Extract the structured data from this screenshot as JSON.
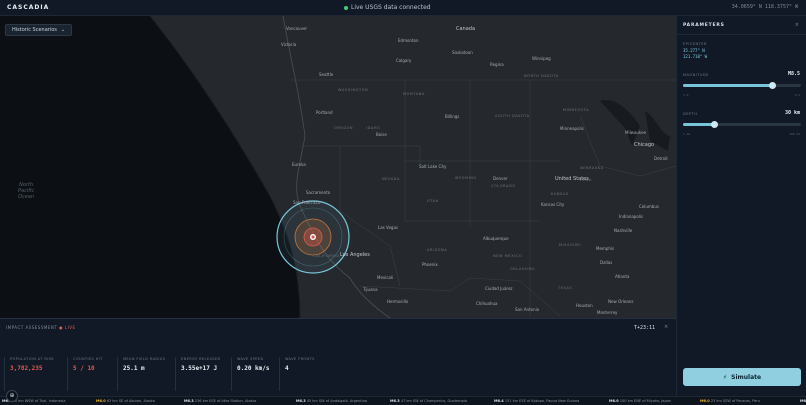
{
  "app": {
    "title": "CASCADIA",
    "status": "Live USGS data connected",
    "status_color": "#3fcf7a",
    "cursor_coords": "34.0659° N 118.3757° W"
  },
  "map": {
    "scenario_button": "Historic Scenarios",
    "ocean_label": "North\nPacific\nOcean",
    "labels": [
      {
        "text": "Canada",
        "kind": "big"
      },
      {
        "text": "Edmonton",
        "kind": "city"
      },
      {
        "text": "Calgary",
        "kind": "city"
      },
      {
        "text": "Saskatoon",
        "kind": "city"
      },
      {
        "text": "Regina",
        "kind": "city"
      },
      {
        "text": "Winnipeg",
        "kind": "city"
      },
      {
        "text": "Vancouver",
        "kind": "city"
      },
      {
        "text": "Victoria",
        "kind": "city"
      },
      {
        "text": "Seattle",
        "kind": "city"
      },
      {
        "text": "WASHINGTON",
        "kind": "state"
      },
      {
        "text": "MONTANA",
        "kind": "state"
      },
      {
        "text": "NORTH DAKOTA",
        "kind": "state"
      },
      {
        "text": "Portland",
        "kind": "city"
      },
      {
        "text": "OREGON",
        "kind": "state"
      },
      {
        "text": "IDAHO",
        "kind": "state"
      },
      {
        "text": "Boise",
        "kind": "city"
      },
      {
        "text": "Billings",
        "kind": "city"
      },
      {
        "text": "SOUTH DAKOTA",
        "kind": "state"
      },
      {
        "text": "MINNESOTA",
        "kind": "state"
      },
      {
        "text": "Minneapolis",
        "kind": "city"
      },
      {
        "text": "Eureka",
        "kind": "city"
      },
      {
        "text": "Salt Lake City",
        "kind": "city"
      },
      {
        "text": "NEVADA",
        "kind": "state"
      },
      {
        "text": "WYOMING",
        "kind": "state"
      },
      {
        "text": "NEBRASKA",
        "kind": "state"
      },
      {
        "text": "IOWA",
        "kind": "state"
      },
      {
        "text": "Milwaukee",
        "kind": "city"
      },
      {
        "text": "Chicago",
        "kind": "big"
      },
      {
        "text": "Detroit",
        "kind": "city"
      },
      {
        "text": "Sacramento",
        "kind": "city"
      },
      {
        "text": "San Francisco",
        "kind": "city"
      },
      {
        "text": "UTAH",
        "kind": "state"
      },
      {
        "text": "Denver",
        "kind": "city"
      },
      {
        "text": "COLORADO",
        "kind": "state"
      },
      {
        "text": "KANSAS",
        "kind": "state"
      },
      {
        "text": "Kansas City",
        "kind": "city"
      },
      {
        "text": "United States",
        "kind": "big"
      },
      {
        "text": "Indianapolis",
        "kind": "city"
      },
      {
        "text": "Columbus",
        "kind": "city"
      },
      {
        "text": "CALIFORNIA",
        "kind": "state"
      },
      {
        "text": "Las Vegas",
        "kind": "city"
      },
      {
        "text": "MISSOURI",
        "kind": "state"
      },
      {
        "text": "Los Angeles",
        "kind": "big"
      },
      {
        "text": "ARIZONA",
        "kind": "state"
      },
      {
        "text": "Albuquerque",
        "kind": "city"
      },
      {
        "text": "NEW MEXICO",
        "kind": "state"
      },
      {
        "text": "OKLAHOMA",
        "kind": "state"
      },
      {
        "text": "Memphis",
        "kind": "city"
      },
      {
        "text": "Nashville",
        "kind": "city"
      },
      {
        "text": "Mexicali",
        "kind": "city"
      },
      {
        "text": "Tijuana",
        "kind": "city"
      },
      {
        "text": "Phoenix",
        "kind": "city"
      },
      {
        "text": "Dallas",
        "kind": "city"
      },
      {
        "text": "Atlanta",
        "kind": "city"
      },
      {
        "text": "Ciudad Juárez",
        "kind": "city"
      },
      {
        "text": "Hermosillo",
        "kind": "city"
      },
      {
        "text": "TEXAS",
        "kind": "state"
      },
      {
        "text": "Houston",
        "kind": "city"
      },
      {
        "text": "Chihuahua",
        "kind": "city"
      },
      {
        "text": "San Antonio",
        "kind": "city"
      },
      {
        "text": "New Orleans",
        "kind": "city"
      },
      {
        "text": "Monterrey",
        "kind": "city"
      }
    ]
  },
  "impact": {
    "title": "IMPACT ASSESSMENT",
    "live": "● LIVE",
    "timer": "T+23:11",
    "close": "×",
    "stats": [
      {
        "label": "POPULATION AT RISK",
        "value": "3,782,235",
        "accent": true
      },
      {
        "label": "COUNTIES HIT",
        "value": "5 / 10",
        "accent": true
      },
      {
        "label": "MEAN FIELD RADIUS",
        "value": "25.1 m",
        "accent": false
      },
      {
        "label": "ENERGY RELEASED",
        "value": "3.55e+17 J",
        "accent": false
      },
      {
        "label": "WAVE SPEED",
        "value": "0.20 km/s",
        "accent": false
      },
      {
        "label": "WAVE FRONTS",
        "value": "4",
        "accent": false
      }
    ]
  },
  "panel": {
    "title": "PARAMETERS",
    "close": "×",
    "epicenter_label": "EPICENTER",
    "epicenter_lat": "35.277° N",
    "epicenter_lon": "121.710° W",
    "magnitude_label": "MAGNITUDE",
    "magnitude_value": "M8.5",
    "magnitude_level": 0.76,
    "magnitude_min": "3.0",
    "magnitude_max": "9.5",
    "depth_label": "DEPTH",
    "depth_value": "30 km",
    "depth_level": 0.27,
    "depth_min": "1 km",
    "depth_max": "100 km",
    "simulate_label": "Simulate",
    "simulate_icon": "lightning-icon",
    "accent": "#79c4d8"
  },
  "ticker": [
    {
      "mag": "M6.",
      "text": "230 km WSW of Tual, Indonesia",
      "hot": false
    },
    {
      "mag": "M6.0",
      "text": "63 km SE of Akutan, Alaska",
      "hot": true
    },
    {
      "mag": "M6.3",
      "text": "236 km ESE of Atka Station, Alaska",
      "hot": false
    },
    {
      "mag": "M6.3",
      "text": "45 km SW of Andalgalá, Argentina",
      "hot": false
    },
    {
      "mag": "M6.3",
      "text": "47 km SW of Champerico, Guatemala",
      "hot": false
    },
    {
      "mag": "M6.4",
      "text": "151 km ESE of Kokopo, Papua New Guinea",
      "hot": false
    },
    {
      "mag": "M6.0",
      "text": "100 km ENE of Miyako, Japan",
      "hot": false
    },
    {
      "mag": "M6.0",
      "text": "23 km SSW of Paracas, Peru",
      "hot": true
    },
    {
      "mag": "M6.",
      "text": "...",
      "hot": false
    }
  ]
}
